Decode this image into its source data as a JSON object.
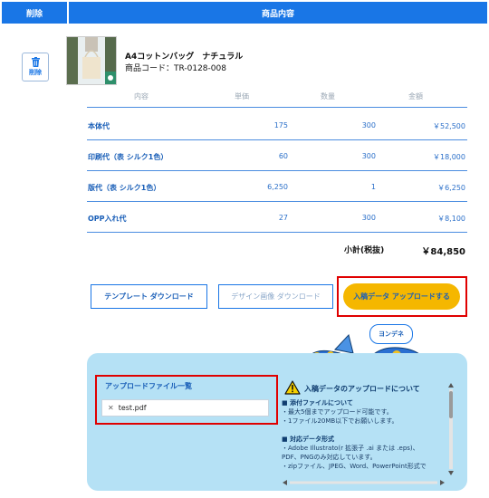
{
  "header": {
    "delete_col": "削除",
    "main_col": "商品内容"
  },
  "delete_button": {
    "label": "削除"
  },
  "product": {
    "name": "A4コットンバッグ　ナチュラル",
    "code": "商品コード：TR-0128-008"
  },
  "table": {
    "headers": [
      "内容",
      "単価",
      "数量",
      "金額"
    ],
    "rows": [
      {
        "label": "本体代",
        "unit": "175",
        "qty": "300",
        "amount": "￥52,500"
      },
      {
        "label": "印刷代（表 シルク1色）",
        "unit": "60",
        "qty": "300",
        "amount": "￥18,000"
      },
      {
        "label": "版代（表 シルク1色）",
        "unit": "6,250",
        "qty": "1",
        "amount": "￥6,250"
      },
      {
        "label": "OPP入れ代",
        "unit": "27",
        "qty": "300",
        "amount": "￥8,100"
      }
    ],
    "subtotal_label": "小計(税抜)",
    "subtotal_value": "￥84,850"
  },
  "buttons": {
    "template_download": "テンプレート ダウンロード",
    "design_download": "デザイン画像 ダウンロード",
    "upload": "入稿データ アップロードする"
  },
  "mascot_bubble": "ヨンデネ",
  "upload_panel": {
    "list_title": "アップロードファイル一覧",
    "file_name": "test.pdf",
    "info_title": "入稿データのアップロードについて",
    "info_lines": [
      "■ 添付ファイルについて",
      "・最大5個までアップロード可能です。",
      "・1ファイル20MB以下でお願いします。",
      "",
      "■ 対応データ形式",
      "・Adobe Illustrato(r 拡張子 .ai または .eps)、",
      "PDF、PNGのみ対応しています。",
      "・zipファイル、JPEG、Word、PowerPoint形式で"
    ]
  },
  "colors": {
    "brand_blue": "#1976e6",
    "upload_yellow": "#f5b700",
    "highlight_red": "#e00000",
    "panel_bg": "#b5e1f5"
  }
}
